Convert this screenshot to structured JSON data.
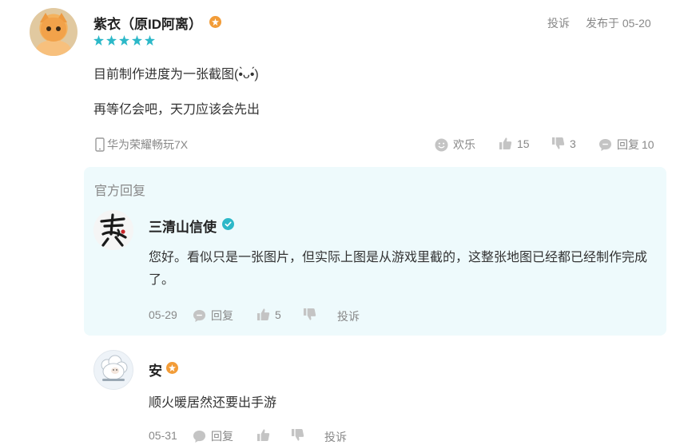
{
  "comment": {
    "username": "紫衣（原ID阿离）",
    "rating_stars": 5,
    "report_label": "投诉",
    "posted_label": "发布于 05-20",
    "lines": [
      "目前制作进度为一张截图(•̀ᴗ•́)",
      "再等亿会吧，天刀应该会先出"
    ],
    "device": "华为荣耀畅玩7X",
    "reactions": {
      "happy_label": "欢乐",
      "likes": "15",
      "dislikes": "3",
      "reply_label": "回复",
      "reply_count": "10"
    }
  },
  "official_reply": {
    "section_title": "官方回复",
    "username": "三清山信使",
    "text": "您好。看似只是一张图片，但实际上图是从游戏里截的，这整张地图已经都已经制作完成了。",
    "date": "05-29",
    "reply_label": "回复",
    "likes": "5",
    "report_label": "投诉"
  },
  "reply_2": {
    "username": "安",
    "text": "顺火暖居然还要出手游",
    "date": "05-31",
    "reply_label": "回复",
    "report_label": "投诉"
  },
  "colors": {
    "star": "#2cb8c8",
    "verified": "#2cb8c8",
    "badge": "#f29c38",
    "muted_text": "#888888",
    "panel_bg": "#eefafc"
  },
  "icons": [
    "phone-icon",
    "smile-icon",
    "thumbs-up-icon",
    "thumbs-down-icon",
    "comment-icon",
    "star-icon",
    "verified-icon",
    "level-badge-icon"
  ]
}
